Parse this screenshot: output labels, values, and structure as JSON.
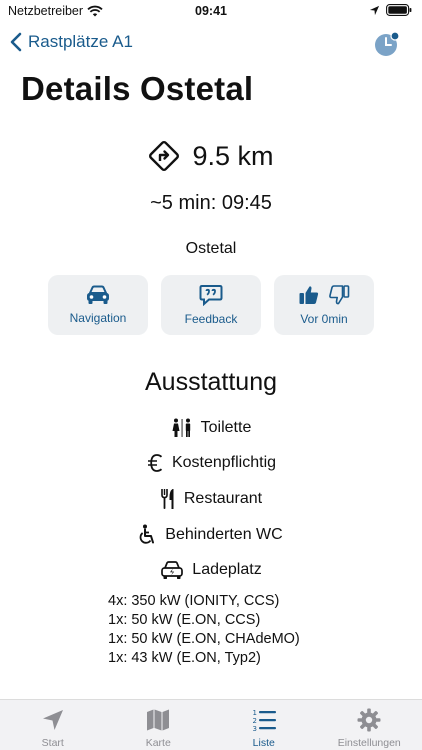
{
  "status_bar": {
    "carrier": "Netzbetreiber",
    "time": "09:41"
  },
  "nav": {
    "back_label": "Rastplätze A1"
  },
  "page": {
    "title": "Details Ostetal"
  },
  "route": {
    "distance": "9.5 km",
    "eta": "~5 min: 09:45",
    "place": "Ostetal"
  },
  "actions": {
    "navigation_label": "Navigation",
    "feedback_label": "Feedback",
    "rating_label": "Vor 0min"
  },
  "amenities": {
    "title": "Ausstattung",
    "items": [
      {
        "icon": "toilet-icon",
        "label": "Toilette"
      },
      {
        "icon": "euro-icon",
        "label": "Kostenpflichtig"
      },
      {
        "icon": "restaurant-icon",
        "label": "Restaurant"
      },
      {
        "icon": "wheelchair-icon",
        "label": "Behinderten WC"
      },
      {
        "icon": "ev-charging-icon",
        "label": "Ladeplatz"
      }
    ]
  },
  "chargers": [
    "4x: 350 kW (IONITY, CCS)",
    "1x: 50 kW (E.ON, CCS)",
    "1x: 50 kW (E.ON, CHAdeMO)",
    "1x: 43 kW (E.ON, Typ2)"
  ],
  "tabs": [
    {
      "label": "Start",
      "icon": "location-arrow-icon",
      "active": false
    },
    {
      "label": "Karte",
      "icon": "map-icon",
      "active": false
    },
    {
      "label": "Liste",
      "icon": "list-icon",
      "active": true
    },
    {
      "label": "Einstellungen",
      "icon": "gear-icon",
      "active": false
    }
  ],
  "colors": {
    "accent": "#1a5b8c",
    "button_bg": "#eef0f2",
    "tab_inactive": "#8e8e93"
  }
}
